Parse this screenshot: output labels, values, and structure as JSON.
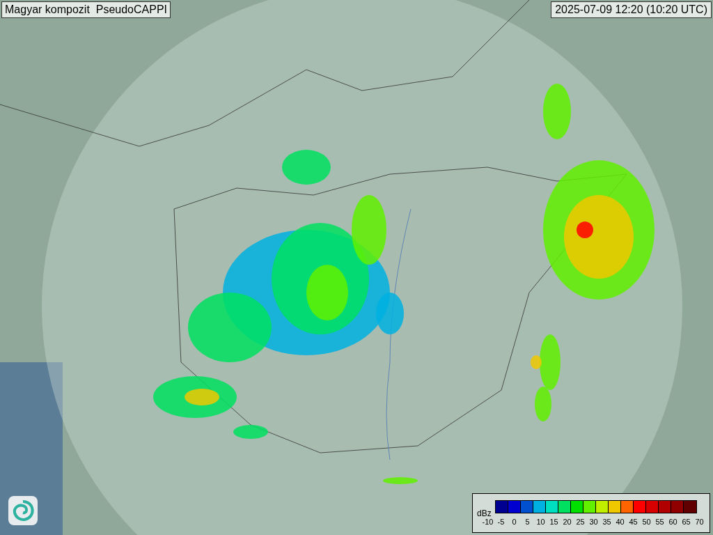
{
  "title": "Magyar kompozit  PseudoCAPPI",
  "timestamp": "2025-07-09 12:20 (10:20 UTC)",
  "legend": {
    "unit": "dBz",
    "bins": [
      {
        "color": "#000090"
      },
      {
        "color": "#0000d0"
      },
      {
        "color": "#0050d0"
      },
      {
        "color": "#00b0e0"
      },
      {
        "color": "#00e0c0"
      },
      {
        "color": "#00e060"
      },
      {
        "color": "#00e000"
      },
      {
        "color": "#60f000"
      },
      {
        "color": "#c0f000"
      },
      {
        "color": "#f0c800"
      },
      {
        "color": "#ff6400"
      },
      {
        "color": "#ff0000"
      },
      {
        "color": "#d80000"
      },
      {
        "color": "#b00000"
      },
      {
        "color": "#900000"
      },
      {
        "color": "#600000"
      }
    ],
    "ticks": [
      "-10",
      "-5",
      "0",
      "5",
      "10",
      "15",
      "20",
      "25",
      "30",
      "35",
      "40",
      "45",
      "50",
      "55",
      "60",
      "65",
      "70"
    ]
  }
}
